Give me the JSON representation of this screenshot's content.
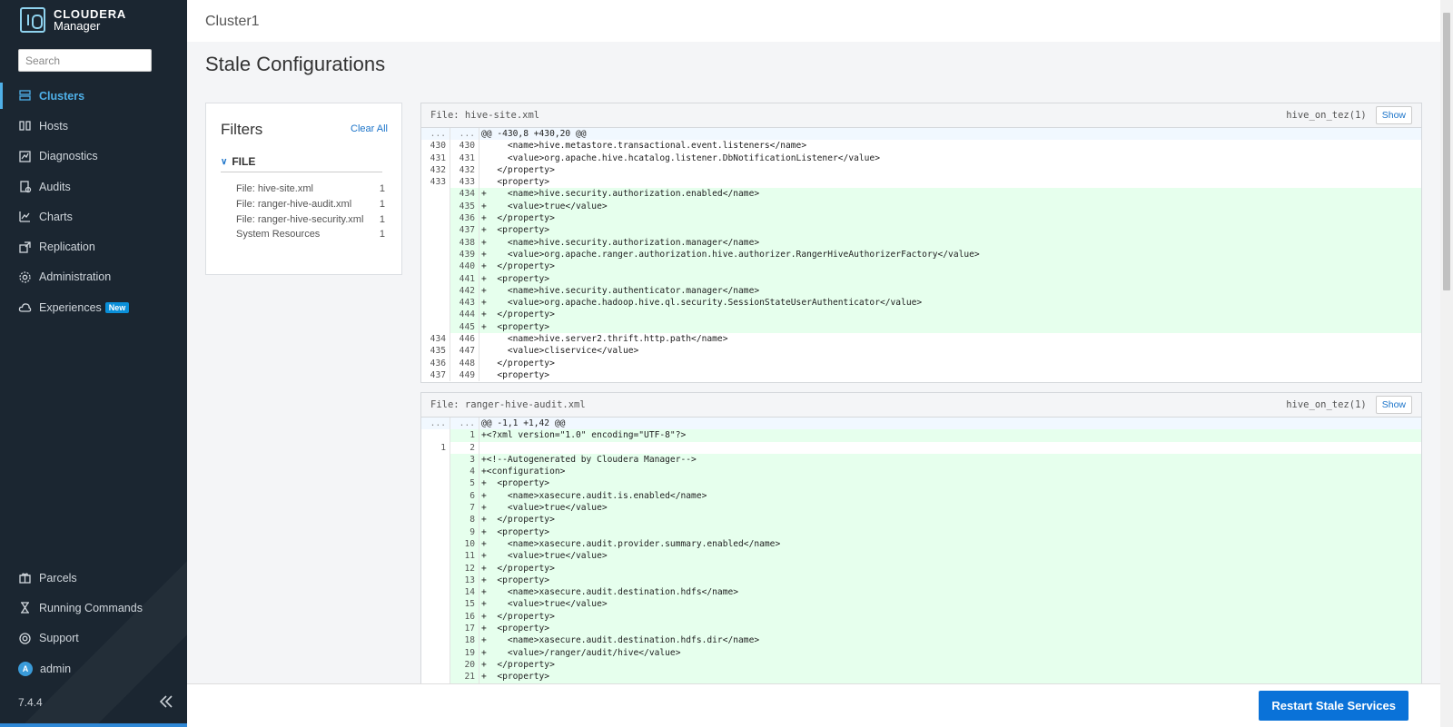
{
  "app": {
    "brand": "CLOUDERA",
    "product": "Manager",
    "version": "7.4.4"
  },
  "search": {
    "placeholder": "Search"
  },
  "nav": [
    {
      "label": "Clusters",
      "icon": "clusters-icon",
      "active": true
    },
    {
      "label": "Hosts",
      "icon": "hosts-icon"
    },
    {
      "label": "Diagnostics",
      "icon": "diagnostics-icon"
    },
    {
      "label": "Audits",
      "icon": "audits-icon"
    },
    {
      "label": "Charts",
      "icon": "charts-icon"
    },
    {
      "label": "Replication",
      "icon": "replication-icon"
    },
    {
      "label": "Administration",
      "icon": "gear-icon"
    },
    {
      "label": "Experiences",
      "icon": "cloud-icon",
      "badge": "New"
    }
  ],
  "nav_bottom": [
    {
      "label": "Parcels",
      "icon": "parcels-icon"
    },
    {
      "label": "Running Commands",
      "icon": "hourglass-icon"
    },
    {
      "label": "Support",
      "icon": "lifebuoy-icon"
    },
    {
      "label": "admin",
      "icon": "avatar",
      "avatar_letter": "A"
    }
  ],
  "header": {
    "cluster": "Cluster1",
    "title": "Stale Configurations"
  },
  "filters": {
    "title": "Filters",
    "clear_all": "Clear All",
    "group": "FILE",
    "items": [
      {
        "label": "File: hive-site.xml",
        "count": "1"
      },
      {
        "label": "File: ranger-hive-audit.xml",
        "count": "1"
      },
      {
        "label": "File: ranger-hive-security.xml",
        "count": "1"
      },
      {
        "label": "System Resources",
        "count": "1"
      }
    ]
  },
  "panels": [
    {
      "file": "File: hive-site.xml",
      "service": "hive_on_tez(1)",
      "show": "Show",
      "lines": [
        [
          "...",
          "...",
          "@@ -430,8 +430,20 @@",
          "hunk"
        ],
        [
          "430",
          "430",
          "     <name>hive.metastore.transactional.event.listeners</name>",
          ""
        ],
        [
          "431",
          "431",
          "     <value>org.apache.hive.hcatalog.listener.DbNotificationListener</value>",
          ""
        ],
        [
          "432",
          "432",
          "   </property>",
          ""
        ],
        [
          "433",
          "433",
          "   <property>",
          ""
        ],
        [
          "",
          "434",
          "+    <name>hive.security.authorization.enabled</name>",
          "add"
        ],
        [
          "",
          "435",
          "+    <value>true</value>",
          "add"
        ],
        [
          "",
          "436",
          "+  </property>",
          "add"
        ],
        [
          "",
          "437",
          "+  <property>",
          "add"
        ],
        [
          "",
          "438",
          "+    <name>hive.security.authorization.manager</name>",
          "add"
        ],
        [
          "",
          "439",
          "+    <value>org.apache.ranger.authorization.hive.authorizer.RangerHiveAuthorizerFactory</value>",
          "add"
        ],
        [
          "",
          "440",
          "+  </property>",
          "add"
        ],
        [
          "",
          "441",
          "+  <property>",
          "add"
        ],
        [
          "",
          "442",
          "+    <name>hive.security.authenticator.manager</name>",
          "add"
        ],
        [
          "",
          "443",
          "+    <value>org.apache.hadoop.hive.ql.security.SessionStateUserAuthenticator</value>",
          "add"
        ],
        [
          "",
          "444",
          "+  </property>",
          "add"
        ],
        [
          "",
          "445",
          "+  <property>",
          "add"
        ],
        [
          "434",
          "446",
          "     <name>hive.server2.thrift.http.path</name>",
          ""
        ],
        [
          "435",
          "447",
          "     <value>cliservice</value>",
          ""
        ],
        [
          "436",
          "448",
          "   </property>",
          ""
        ],
        [
          "437",
          "449",
          "   <property>",
          ""
        ]
      ]
    },
    {
      "file": "File: ranger-hive-audit.xml",
      "service": "hive_on_tez(1)",
      "show": "Show",
      "lines": [
        [
          "...",
          "...",
          "@@ -1,1 +1,42 @@",
          "hunk"
        ],
        [
          "",
          "1",
          "+<?xml version=\"1.0\" encoding=\"UTF-8\"?>",
          "add"
        ],
        [
          "1",
          "2",
          "",
          ""
        ],
        [
          "",
          "3",
          "+<!--Autogenerated by Cloudera Manager-->",
          "add"
        ],
        [
          "",
          "4",
          "+<configuration>",
          "add"
        ],
        [
          "",
          "5",
          "+  <property>",
          "add"
        ],
        [
          "",
          "6",
          "+    <name>xasecure.audit.is.enabled</name>",
          "add"
        ],
        [
          "",
          "7",
          "+    <value>true</value>",
          "add"
        ],
        [
          "",
          "8",
          "+  </property>",
          "add"
        ],
        [
          "",
          "9",
          "+  <property>",
          "add"
        ],
        [
          "",
          "10",
          "+    <name>xasecure.audit.provider.summary.enabled</name>",
          "add"
        ],
        [
          "",
          "11",
          "+    <value>true</value>",
          "add"
        ],
        [
          "",
          "12",
          "+  </property>",
          "add"
        ],
        [
          "",
          "13",
          "+  <property>",
          "add"
        ],
        [
          "",
          "14",
          "+    <name>xasecure.audit.destination.hdfs</name>",
          "add"
        ],
        [
          "",
          "15",
          "+    <value>true</value>",
          "add"
        ],
        [
          "",
          "16",
          "+  </property>",
          "add"
        ],
        [
          "",
          "17",
          "+  <property>",
          "add"
        ],
        [
          "",
          "18",
          "+    <name>xasecure.audit.destination.hdfs.dir</name>",
          "add"
        ],
        [
          "",
          "19",
          "+    <value>/ranger/audit/hive</value>",
          "add"
        ],
        [
          "",
          "20",
          "+  </property>",
          "add"
        ],
        [
          "",
          "21",
          "+  <property>",
          "add"
        ]
      ]
    }
  ],
  "footer": {
    "restart": "Restart Stale Services"
  }
}
